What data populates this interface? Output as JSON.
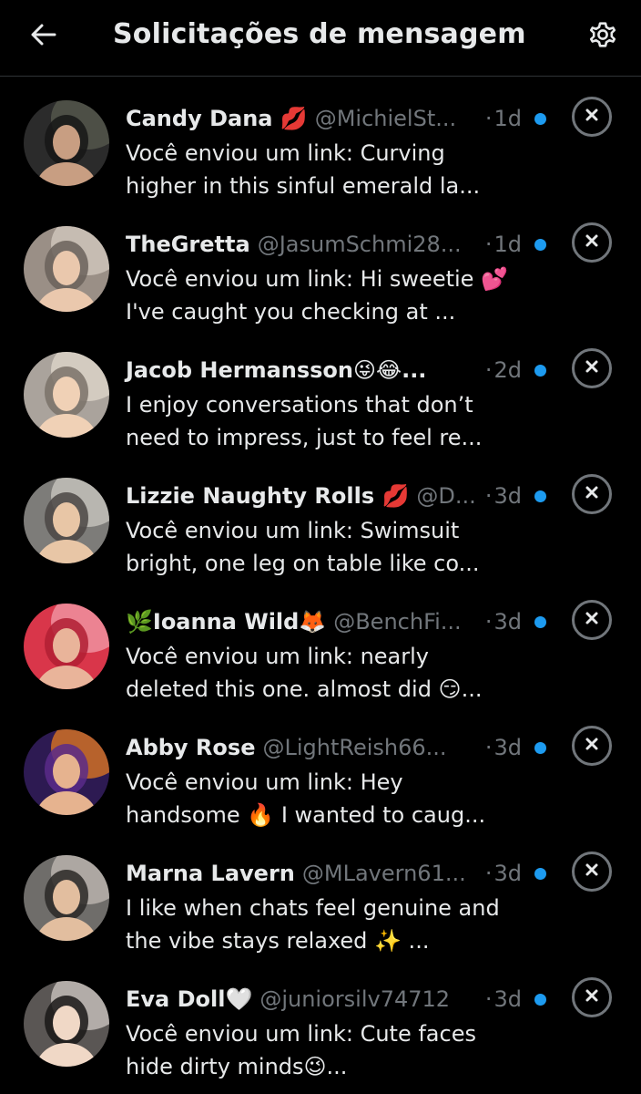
{
  "header": {
    "title": "Solicitações de mensagem",
    "back_icon": "arrow-left-icon",
    "settings_icon": "gear-icon"
  },
  "colors": {
    "background": "#000000",
    "text": "#e7e9ea",
    "muted": "#71767b",
    "unread_dot": "#1d9bf0"
  },
  "requests": [
    {
      "name": "Candy Dana 💋",
      "handle": "@MichielSt...",
      "dot": "·",
      "time": "1d",
      "preview": "Você enviou um link: Curving higher in this sinful emerald la...",
      "unread": true
    },
    {
      "name": "TheGretta",
      "handle": "@JasumSchmi28...",
      "dot": "·",
      "time": "1d",
      "preview": "Você enviou um link: Hi sweetie 💕 I've caught you checking at ...",
      "unread": true
    },
    {
      "name": "Jacob Hermansson😜😂...",
      "handle": "",
      "dot": "·",
      "time": "2d",
      "preview": "I enjoy conversations that don’t need to impress, just to feel re...",
      "unread": true
    },
    {
      "name": "Lizzie Naughty Rolls 💋",
      "handle": "@D...",
      "dot": "·",
      "time": "3d",
      "preview": "Você enviou um link: Swimsuit bright, one leg on table like co...",
      "unread": true
    },
    {
      "name": "🌿Ioanna Wild🦊",
      "handle": "@BenchFi...",
      "dot": "·",
      "time": "3d",
      "preview": "Você enviou um link: nearly deleted this one. almost did 😏...",
      "unread": true
    },
    {
      "name": "Abby Rose",
      "handle": "@LightReish66...",
      "dot": "·",
      "time": "3d",
      "preview": "Você enviou um link: Hey handsome 🔥 I wanted to caug...",
      "unread": true
    },
    {
      "name": "Marna Lavern",
      "handle": "@MLavern61...",
      "dot": "·",
      "time": "3d",
      "preview": "I like when chats feel genuine and the vibe stays relaxed ✨ ...",
      "unread": true
    },
    {
      "name": "Eva Doll🤍",
      "handle": "@juniorsilv74712",
      "dot": "·",
      "time": "3d",
      "preview": "Você enviou um link: Cute faces hide dirty minds😉...",
      "unread": true
    }
  ]
}
